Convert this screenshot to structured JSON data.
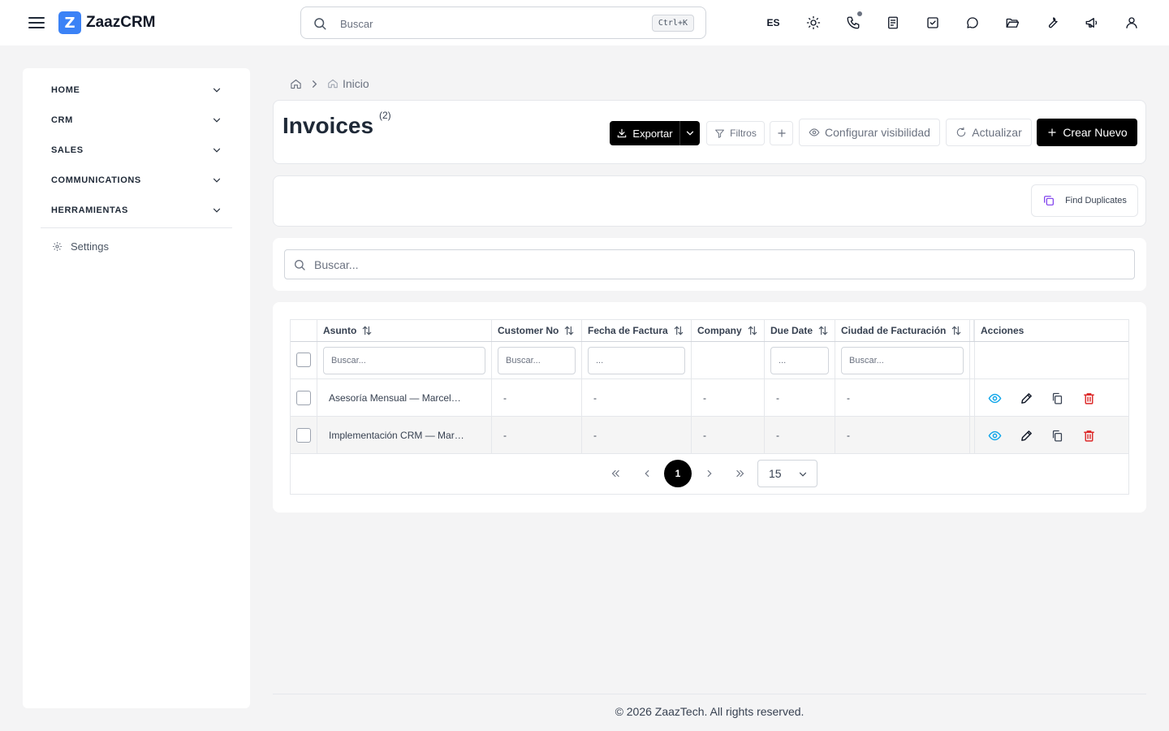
{
  "app": {
    "logo_letter": "Z",
    "name": "ZaazCRM"
  },
  "topbar": {
    "search_placeholder": "Buscar",
    "shortcut": "Ctrl+K",
    "language": "ES",
    "icons": [
      "theme-sun-icon",
      "phone-icon",
      "notes-icon",
      "tasks-check-icon",
      "chat-icon",
      "folder-icon",
      "tools-wrench-icon",
      "megaphone-icon",
      "user-icon"
    ]
  },
  "sidebar": {
    "items": [
      {
        "label": "HOME"
      },
      {
        "label": "CRM"
      },
      {
        "label": "SALES"
      },
      {
        "label": "COMMUNICATIONS"
      },
      {
        "label": "HERRAMIENTAS"
      }
    ],
    "settings_label": "Settings"
  },
  "breadcrumb": {
    "current": "Inicio"
  },
  "header": {
    "title": "Invoices",
    "count": "(2)",
    "export_label": "Exportar",
    "filters_label": "Filtros",
    "visibility_label": "Configurar visibilidad",
    "refresh_label": "Actualizar",
    "create_label": "Crear Nuevo"
  },
  "duplicates": {
    "label": "Find Duplicates"
  },
  "search": {
    "placeholder": "Buscar..."
  },
  "table": {
    "columns": [
      {
        "label": "Asunto",
        "filter_placeholder": "Buscar..."
      },
      {
        "label": "Customer No",
        "filter_placeholder": "Buscar..."
      },
      {
        "label": "Fecha de Factura",
        "filter_placeholder": "..."
      },
      {
        "label": "Company",
        "filter_placeholder": ""
      },
      {
        "label": "Due Date",
        "filter_placeholder": "..."
      },
      {
        "label": "Ciudad de Facturación",
        "filter_placeholder": "Buscar..."
      }
    ],
    "actions_label": "Acciones",
    "rows": [
      {
        "subject": "Asesoría Mensual — Marcel…",
        "customer_no": "-",
        "invoice_date": "-",
        "company": "-",
        "due_date": "-",
        "billing_city": "-"
      },
      {
        "subject": "Implementación CRM — Mar…",
        "customer_no": "-",
        "invoice_date": "-",
        "company": "-",
        "due_date": "-",
        "billing_city": "-"
      }
    ]
  },
  "pagination": {
    "current_page": "1",
    "page_size": "15"
  },
  "footer": {
    "text": "© 2026 ZaazTech. All rights reserved."
  },
  "colors": {
    "accent": "#3b82f6",
    "primary_button": "#000000",
    "view_action": "#0ea5e9",
    "delete_action": "#dc2626",
    "duplicate_icon": "#7c3aed"
  }
}
